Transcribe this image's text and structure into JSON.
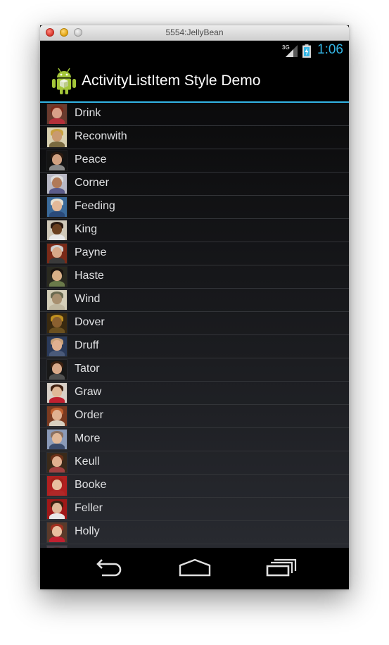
{
  "window": {
    "title": "5554:JellyBean"
  },
  "statusbar": {
    "network": "3G",
    "time": "1:06"
  },
  "actionbar": {
    "title": "ActivityListItem Style Demo"
  },
  "list": {
    "items": [
      {
        "label": "Drink",
        "bg": "#6a3b2e",
        "skin": "#d9a088",
        "hair": "#7a2a1a",
        "shirt": "#b3303a"
      },
      {
        "label": "Reconwith",
        "bg": "#d8d0b0",
        "skin": "#c99a70",
        "hair": "#c8a040",
        "shirt": "#7a6a40"
      },
      {
        "label": "Peace",
        "bg": "#141414",
        "skin": "#d0a080",
        "hair": "#2a1a10",
        "shirt": "#8a8a8a"
      },
      {
        "label": "Corner",
        "bg": "#b8b8c4",
        "skin": "#b07a58",
        "hair": "#dcdcdc",
        "shirt": "#5b5b8a"
      },
      {
        "label": "Feeding",
        "bg": "#3b6a9a",
        "skin": "#e2b898",
        "hair": "#e6e0d2",
        "shirt": "#2a4a7a"
      },
      {
        "label": "King",
        "bg": "#cfc8b8",
        "skin": "#6a4020",
        "hair": "#2a1a10",
        "shirt": "#e8e8e8"
      },
      {
        "label": "Payne",
        "bg": "#7a2a18",
        "skin": "#d8a888",
        "hair": "#cfcfcf",
        "shirt": "#3a3a3a"
      },
      {
        "label": "Haste",
        "bg": "#2a2a20",
        "skin": "#d8b088",
        "hair": "#1a1410",
        "shirt": "#6a7a4a"
      },
      {
        "label": "Wind",
        "bg": "#d4ceb8",
        "skin": "#a89070",
        "hair": "#6a6a50",
        "shirt": "#c0b8a0"
      },
      {
        "label": "Dover",
        "bg": "#3a2a10",
        "skin": "#8a6030",
        "hair": "#c09020",
        "shirt": "#6a5020"
      },
      {
        "label": "Druff",
        "bg": "#2a3a5a",
        "skin": "#e0b090",
        "hair": "#c8a078",
        "shirt": "#4a5a7a"
      },
      {
        "label": "Tator",
        "bg": "#181818",
        "skin": "#d8a888",
        "hair": "#3a2010",
        "shirt": "#505050"
      },
      {
        "label": "Graw",
        "bg": "#d8d0c8",
        "skin": "#e0b898",
        "hair": "#402010",
        "shirt": "#c02030"
      },
      {
        "label": "Order",
        "bg": "#7a3a20",
        "skin": "#e0b090",
        "hair": "#c06030",
        "shirt": "#d8d0c0"
      },
      {
        "label": "More",
        "bg": "#8a9ab8",
        "skin": "#e0b898",
        "hair": "#8a7060",
        "shirt": "#3a4a6a"
      },
      {
        "label": "Keull",
        "bg": "#3a2a1a",
        "skin": "#e0b090",
        "hair": "#6a3018",
        "shirt": "#a04040"
      },
      {
        "label": "Booke",
        "bg": "#b02020",
        "skin": "#e8c0a0",
        "hair": "#a02018",
        "shirt": "#b02828"
      },
      {
        "label": "Feller",
        "bg": "#a01818",
        "skin": "#e0b898",
        "hair": "#3a2010",
        "shirt": "#e8e8e8"
      },
      {
        "label": "Holly",
        "bg": "#5a3a2a",
        "skin": "#e8c0a0",
        "hair": "#a03020",
        "shirt": "#c02030"
      },
      {
        "label": "",
        "bg": "#4a4048",
        "skin": "#b89080",
        "hair": "#4a3030",
        "shirt": "#4a4048"
      }
    ]
  },
  "colors": {
    "accent": "#33b5e5",
    "text": "#dfe0e2"
  }
}
